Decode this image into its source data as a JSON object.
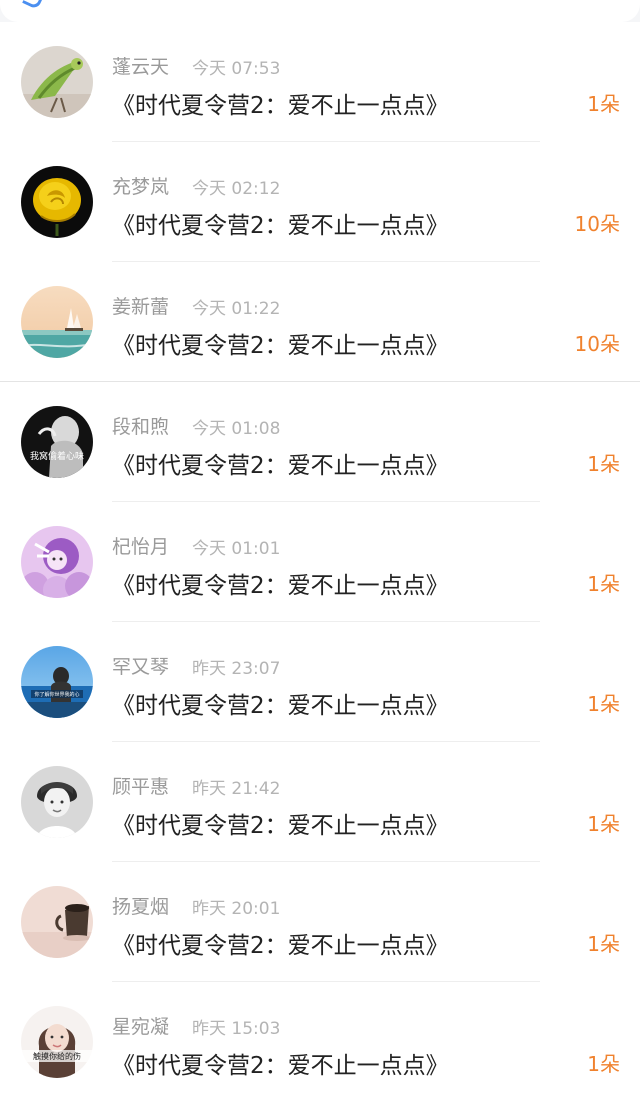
{
  "colors": {
    "accent": "#f0822e",
    "name_text": "#9a9a9a",
    "time_text": "#b4b4b4",
    "title_text": "#222222"
  },
  "gifts": [
    {
      "name": "蓬云天",
      "time": "今天 07:53",
      "title": "《时代夏令营2：爱不止一点点》",
      "count": "1朵",
      "avatar_icon": "parrot-avatar"
    },
    {
      "name": "充梦岚",
      "time": "今天 02:12",
      "title": "《时代夏令营2：爱不止一点点》",
      "count": "10朵",
      "avatar_icon": "yellow-rose-avatar"
    },
    {
      "name": "姜新蕾",
      "time": "今天 01:22",
      "title": "《时代夏令营2：爱不止一点点》",
      "count": "10朵",
      "avatar_icon": "seaside-avatar"
    },
    {
      "name": "段和煦",
      "time": "今天 01:08",
      "title": "《时代夏令营2：爱不止一点点》",
      "count": "1朵",
      "avatar_icon": "dark-photo-avatar"
    },
    {
      "name": "杞怡月",
      "time": "今天 01:01",
      "title": "《时代夏令营2：爱不止一点点》",
      "count": "1朵",
      "avatar_icon": "purple-cartoon-avatar"
    },
    {
      "name": "罕又琴",
      "time": "昨天 23:07",
      "title": "《时代夏令营2：爱不止一点点》",
      "count": "1朵",
      "avatar_icon": "ocean-girl-avatar"
    },
    {
      "name": "顾平惠",
      "time": "昨天 21:42",
      "title": "《时代夏令营2：爱不止一点点》",
      "count": "1朵",
      "avatar_icon": "monochrome-girl-avatar"
    },
    {
      "name": "扬夏烟",
      "time": "昨天 20:01",
      "title": "《时代夏令营2：爱不止一点点》",
      "count": "1朵",
      "avatar_icon": "tea-cup-avatar"
    },
    {
      "name": "星宛凝",
      "time": "昨天 15:03",
      "title": "《时代夏令营2：爱不止一点点》",
      "count": "1朵",
      "avatar_icon": "girl-with-text-avatar"
    }
  ],
  "avatar_captions": {
    "dark_photo": "我窝偷着心味",
    "ocean_girl": "你了解你世界我的心",
    "girl_with_text": "触摸你给的伤"
  }
}
